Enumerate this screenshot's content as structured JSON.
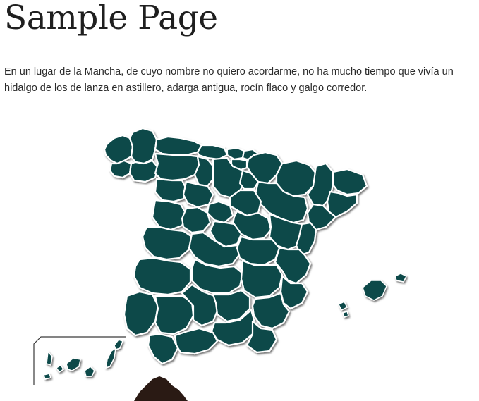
{
  "page": {
    "title": "Sample Page",
    "intro": "En un lugar de la Mancha, de cuyo nombre no quiero acordarme, no ha mucho tiempo que vivía un hidalgo de los de lanza en astillero, adarga antigua, rocín flaco y galgo corredor."
  },
  "map": {
    "fill_color": "#0b4a4a",
    "border_color": "#ffffff",
    "africa_color": "#2a1a14"
  }
}
